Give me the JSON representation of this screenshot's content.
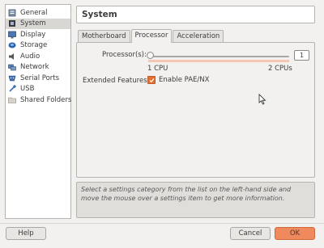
{
  "sidebar": {
    "items": [
      {
        "label": "General",
        "icon": "general-icon"
      },
      {
        "label": "System",
        "icon": "system-icon",
        "selected": true
      },
      {
        "label": "Display",
        "icon": "display-icon"
      },
      {
        "label": "Storage",
        "icon": "storage-icon"
      },
      {
        "label": "Audio",
        "icon": "audio-icon"
      },
      {
        "label": "Network",
        "icon": "network-icon"
      },
      {
        "label": "Serial Ports",
        "icon": "serial-ports-icon"
      },
      {
        "label": "USB",
        "icon": "usb-icon"
      },
      {
        "label": "Shared Folders",
        "icon": "shared-folders-icon"
      }
    ]
  },
  "page": {
    "title": "System"
  },
  "tabs": [
    "Motherboard",
    "Processor",
    "Acceleration"
  ],
  "processor": {
    "label": "Processor(s):",
    "value": "1",
    "min_label": "1 CPU",
    "max_label": "2 CPUs",
    "slider_fraction": 0
  },
  "extended": {
    "label": "Extended Features:",
    "checkbox_label": "Enable PAE/NX",
    "checked": true
  },
  "info": {
    "text": "Select a settings category from the list on the left-hand side and move the mouse over a settings item to get more information."
  },
  "footer": {
    "help": "Help",
    "cancel": "Cancel",
    "ok": "OK"
  },
  "colors": {
    "accent": "#f08a5d",
    "checkbox": "#e4702f",
    "range": "#f4c6b4"
  }
}
